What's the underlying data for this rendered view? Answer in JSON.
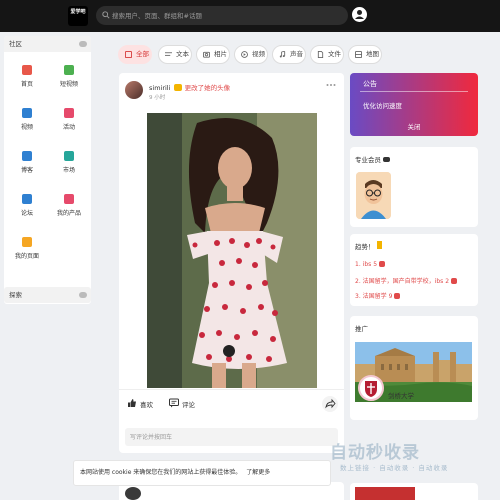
{
  "header": {
    "logo_text": "爱学吧",
    "search_placeholder": "搜索用户、页面、群组和#话题"
  },
  "sidebar": {
    "title": "社区",
    "items": [
      {
        "label": "首页",
        "icon": "home-icon",
        "color": "#e8584a"
      },
      {
        "label": "短视频",
        "icon": "video-icon",
        "color": "#4cb050"
      },
      {
        "label": "视频",
        "icon": "play-icon",
        "color": "#2f80d1"
      },
      {
        "label": "活动",
        "icon": "calendar-icon",
        "color": "#e64a6b"
      },
      {
        "label": "博客",
        "icon": "blog-icon",
        "color": "#2f80d1"
      },
      {
        "label": "市场",
        "icon": "market-icon",
        "color": "#26a69a"
      },
      {
        "label": "论坛",
        "icon": "forum-icon",
        "color": "#2f80d1"
      },
      {
        "label": "我的产品",
        "icon": "product-icon",
        "color": "#e64a6b"
      },
      {
        "label": "我的页面",
        "icon": "page-icon",
        "color": "#f5a623"
      }
    ],
    "explore_label": "探索"
  },
  "tabs": [
    {
      "label": "全部",
      "icon": "all-icon",
      "active": true
    },
    {
      "label": "文本",
      "icon": "text-icon",
      "active": false
    },
    {
      "label": "相片",
      "icon": "photo-icon",
      "active": false
    },
    {
      "label": "视频",
      "icon": "video-tab-icon",
      "active": false
    },
    {
      "label": "声音",
      "icon": "music-icon",
      "active": false
    },
    {
      "label": "文件",
      "icon": "file-icon",
      "active": false
    },
    {
      "label": "地图",
      "icon": "map-icon",
      "active": false
    }
  ],
  "post": {
    "username": "simirili",
    "action": "更改了她的头像",
    "time": "9 小时",
    "like_label": "喜欢",
    "comment_label": "评论",
    "comment_placeholder": "写评论并按回车"
  },
  "notice": {
    "title": "公告",
    "body": "优化访问速度",
    "button": "关闭"
  },
  "member": {
    "title": "专业会员"
  },
  "trends": {
    "title": "趋势！",
    "items": [
      {
        "num": "1.",
        "text": "ibs",
        "count": "5"
      },
      {
        "num": "2.",
        "text": "法国留学，国产自带学校，ibs",
        "count": "2"
      },
      {
        "num": "3.",
        "text": "法国留学",
        "count": "9"
      }
    ]
  },
  "recommend": {
    "title": "推广",
    "name": "剑桥大学"
  },
  "cookie": {
    "text": "本网站使用 cookie 来确保您在我们的网站上获得最佳体验。",
    "link": "了解更多"
  },
  "watermark": {
    "main": "自动秒收录",
    "sub": "数上链接 · 自动收录 · 自动收录"
  }
}
